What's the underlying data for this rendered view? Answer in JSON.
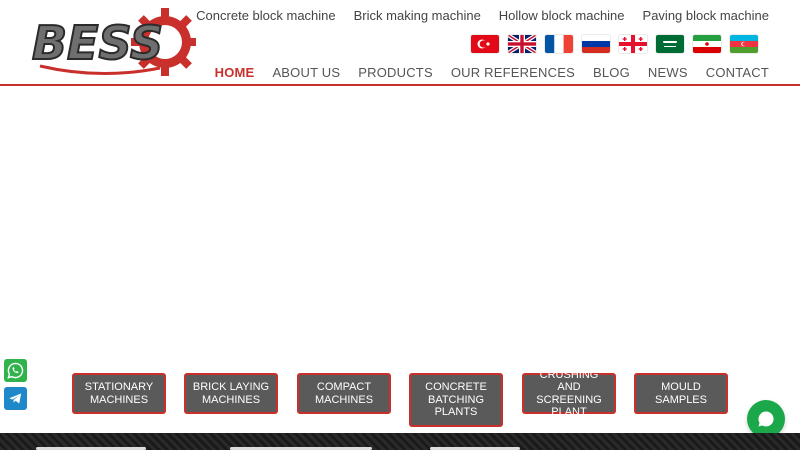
{
  "brand": {
    "logo_text": "BESS",
    "logo_icon": "gear-icon",
    "accent": "#c9302c"
  },
  "top_links": [
    "Concrete block machine",
    "Brick making machine",
    "Hollow block machine",
    "Paving block machine"
  ],
  "flags": [
    {
      "name": "turkish-flag-icon"
    },
    {
      "name": "english-flag-icon"
    },
    {
      "name": "french-flag-icon"
    },
    {
      "name": "russian-flag-icon"
    },
    {
      "name": "georgian-flag-icon"
    },
    {
      "name": "arabic-flag-icon"
    },
    {
      "name": "persian-flag-icon"
    },
    {
      "name": "azerbaijani-flag-icon"
    }
  ],
  "nav": {
    "items": [
      "HOME",
      "ABOUT US",
      "PRODUCTS",
      "OUR REFERENCES",
      "BLOG",
      "NEWS",
      "CONTACT"
    ],
    "active": "HOME"
  },
  "categories": [
    "STATIONARY MACHINES",
    "BRICK LAYING MACHINES",
    "COMPACT MACHINES",
    "CONCRETE BATCHING PLANTS",
    "CRUSHING AND SCREENING PLANT",
    "MOULD SAMPLES"
  ],
  "social": {
    "whatsapp": "whatsapp-icon",
    "telegram": "telegram-icon"
  },
  "chat": {
    "icon": "chat-bubble-icon"
  }
}
